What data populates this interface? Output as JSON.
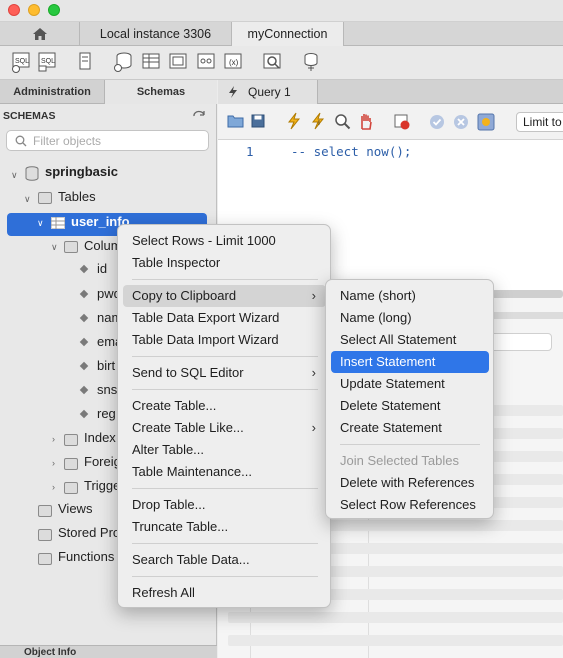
{
  "window": {
    "tabs": [
      {
        "label": "Local instance 3306"
      },
      {
        "label": "myConnection"
      }
    ]
  },
  "sidebar": {
    "tabs": [
      "Administration",
      "Schemas"
    ],
    "header": "SCHEMAS",
    "search_placeholder": "Filter objects",
    "schema": "springbasic",
    "tables_label": "Tables",
    "table": "user_info",
    "columns_label": "Colum",
    "columns": [
      "id",
      "pwd",
      "nam",
      "ema",
      "birt",
      "sns",
      "reg"
    ],
    "indexes_label": "Index",
    "foreign_label": "Foreig",
    "triggers_label": "Trigge",
    "views_label": "Views",
    "procs_label": "Stored Pro",
    "functions_label": "Functions",
    "bottom_tab": "Object Info"
  },
  "query": {
    "tab_label": "Query 1",
    "limit_label": "Limit to",
    "line_number": "1",
    "code": "-- select now();"
  },
  "context_menu": {
    "items": [
      "Select Rows - Limit 1000",
      "Table Inspector",
      "Copy to Clipboard",
      "Table Data Export Wizard",
      "Table Data Import Wizard",
      "Send to SQL Editor",
      "Create Table...",
      "Create Table Like...",
      "Alter Table...",
      "Table Maintenance...",
      "Drop Table...",
      "Truncate Table...",
      "Search Table Data...",
      "Refresh All"
    ],
    "submenu_arrow": "›"
  },
  "submenu": {
    "items": [
      "Name (short)",
      "Name (long)",
      "Select All Statement",
      "Insert Statement",
      "Update Statement",
      "Delete Statement",
      "Create Statement",
      "Join Selected Tables",
      "Delete with References",
      "Select Row References"
    ]
  },
  "colors": {
    "accent": "#2f76e8",
    "selection": "#2f6fd8",
    "code": "#2c5ea8"
  }
}
